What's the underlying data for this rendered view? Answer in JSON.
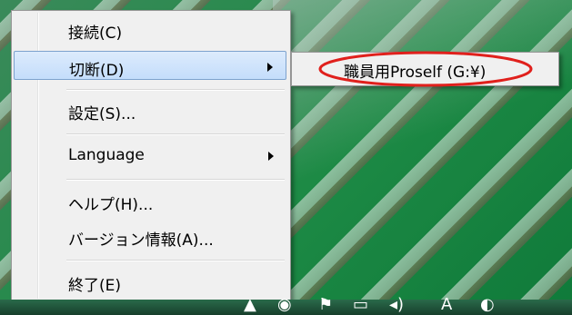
{
  "menu": {
    "items": [
      {
        "label": "接続(C)",
        "submenu": false,
        "highlighted": false
      },
      {
        "label": "切断(D)",
        "submenu": true,
        "highlighted": true
      },
      {
        "label": "設定(S)...",
        "submenu": false,
        "highlighted": false
      },
      {
        "label": "Language",
        "submenu": true,
        "highlighted": false
      },
      {
        "label": "ヘルプ(H)...",
        "submenu": false,
        "highlighted": false
      },
      {
        "label": "バージョン情報(A)...",
        "submenu": false,
        "highlighted": false
      },
      {
        "label": "終了(E)",
        "submenu": false,
        "highlighted": false
      }
    ]
  },
  "submenu": {
    "items": [
      {
        "label": "職員用Proself (G:¥)"
      }
    ]
  },
  "annotation": {
    "color": "#e0201c",
    "shape": "ellipse"
  },
  "tray": {
    "icons": [
      "chevron-up-icon",
      "network-icon",
      "flag-icon",
      "monitor-icon",
      "speaker-icon",
      "ime-icon",
      "app-icon"
    ],
    "ime_label": "A"
  },
  "colors": {
    "highlight": "#cde3fb",
    "menu_bg": "#f0f0f0",
    "desktop": "#1d8a45"
  }
}
